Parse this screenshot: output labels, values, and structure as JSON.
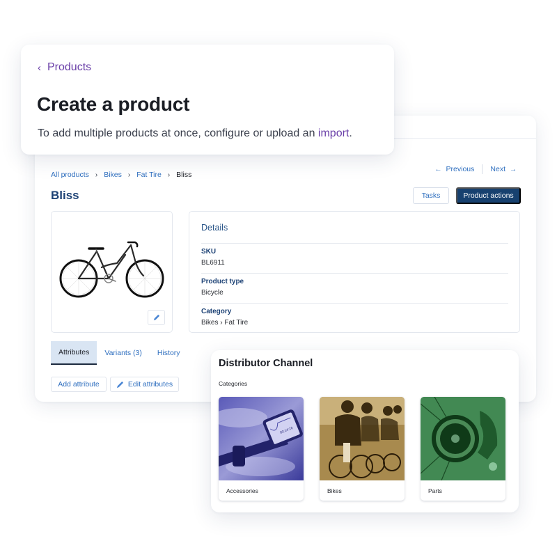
{
  "create_card": {
    "back_link": "Products",
    "title": "Create a product",
    "description_prefix": "To add multiple products at once, configure or upload an ",
    "import_link": "import",
    "description_suffix": ".",
    "accent_color": "#6a3fa8"
  },
  "product_page": {
    "breadcrumb": [
      {
        "label": "All products"
      },
      {
        "label": "Bikes"
      },
      {
        "label": "Fat Tire"
      },
      {
        "label": "Bliss"
      }
    ],
    "pager": {
      "previous": "Previous",
      "next": "Next"
    },
    "title": "Bliss",
    "buttons": {
      "tasks": "Tasks",
      "product_actions": "Product actions"
    },
    "image": {
      "alt": "bicycle",
      "edit_icon": "pencil-icon"
    },
    "details": {
      "title": "Details",
      "rows": [
        {
          "label": "SKU",
          "value": "BL6911"
        },
        {
          "label": "Product type",
          "value": "Bicycle"
        },
        {
          "label": "Category",
          "value": "Bikes › Fat Tire"
        }
      ]
    },
    "tabs": [
      {
        "label": "Attributes",
        "active": true
      },
      {
        "label": "Variants (3)",
        "active": false
      },
      {
        "label": "History",
        "active": false
      }
    ],
    "attribute_buttons": {
      "add": "Add attribute",
      "edit": "Edit attributes"
    },
    "colors": {
      "primary": "#17416f",
      "link": "#2f6fbf",
      "heading": "#1d4275"
    }
  },
  "distributor": {
    "title": "Distributor Channel",
    "subtitle": "Categories",
    "categories": [
      {
        "label": "Accessories",
        "tint": "#2a2a8a"
      },
      {
        "label": "Bikes",
        "tint": "#7a5a1e"
      },
      {
        "label": "Parts",
        "tint": "#1f7a3a"
      }
    ]
  }
}
